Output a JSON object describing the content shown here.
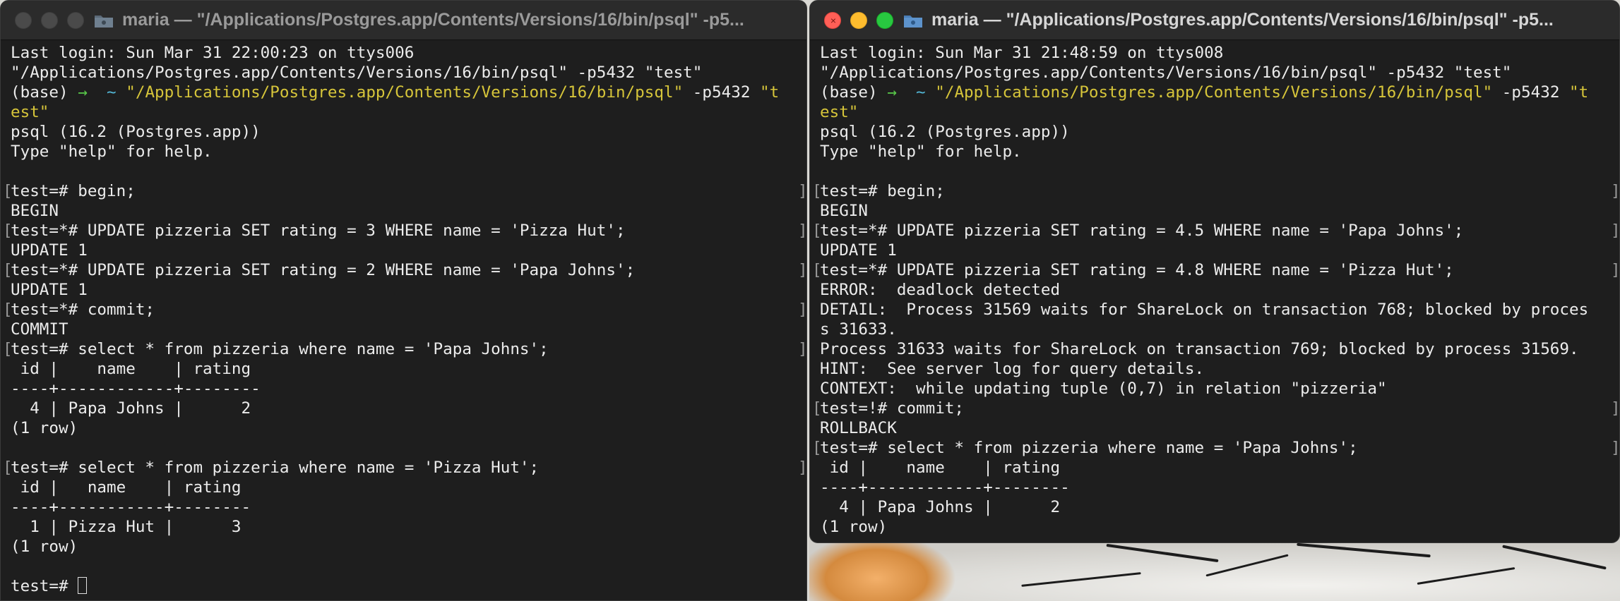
{
  "colors": {
    "terminal_bg": "#1e1e1e",
    "text": "#ececec",
    "prompt_arrow": "#59c94a",
    "prompt_tilde": "#53b7d6",
    "command_text": "#d6c53a",
    "close": "#ff5f57",
    "minimize": "#febc2e",
    "zoom": "#28c840"
  },
  "left": {
    "title": "maria — \"/Applications/Postgres.app/Contents/Versions/16/bin/psql\" -p5...",
    "lines": [
      "Last login: Sun Mar 31 22:00:23 on ttys006",
      "\"/Applications/Postgres.app/Contents/Versions/16/bin/psql\" -p5432 \"test\"",
      {
        "base": "(base) ",
        "arrow": "→ ",
        "tilde": " ~ ",
        "cmd": "\"/Applications/Postgres.app/Contents/Versions/16/bin/psql\"",
        "opt": " -p5432 ",
        "arg": "\"t"
      },
      "est\"",
      "psql (16.2 (Postgres.app))",
      "Type \"help\" for help.",
      "",
      "test=# begin;",
      "BEGIN",
      "test=*# UPDATE pizzeria SET rating = 3 WHERE name = 'Pizza Hut';",
      "UPDATE 1",
      "test=*# UPDATE pizzeria SET rating = 2 WHERE name = 'Papa Johns';",
      "UPDATE 1",
      "test=*# commit;",
      "COMMIT",
      "test=# select * from pizzeria where name = 'Papa Johns';",
      " id |    name    | rating",
      "----+------------+--------",
      "  4 | Papa Johns |      2",
      "(1 row)",
      "",
      "test=# select * from pizzeria where name = 'Pizza Hut';",
      " id |   name    | rating",
      "----+-----------+--------",
      "  1 | Pizza Hut |      3",
      "(1 row)",
      "",
      "test=# "
    ]
  },
  "right": {
    "title": "maria — \"/Applications/Postgres.app/Contents/Versions/16/bin/psql\" -p5...",
    "lines": [
      "Last login: Sun Mar 31 21:48:59 on ttys008",
      "\"/Applications/Postgres.app/Contents/Versions/16/bin/psql\" -p5432 \"test\"",
      {
        "base": "(base) ",
        "arrow": "→ ",
        "tilde": " ~ ",
        "cmd": "\"/Applications/Postgres.app/Contents/Versions/16/bin/psql\"",
        "opt": " -p5432 ",
        "arg": "\"t"
      },
      "est\"",
      "psql (16.2 (Postgres.app))",
      "Type \"help\" for help.",
      "",
      "test=# begin;",
      "BEGIN",
      "test=*# UPDATE pizzeria SET rating = 4.5 WHERE name = 'Papa Johns';",
      "UPDATE 1",
      "test=*# UPDATE pizzeria SET rating = 4.8 WHERE name = 'Pizza Hut';",
      "ERROR:  deadlock detected",
      "DETAIL:  Process 31569 waits for ShareLock on transaction 768; blocked by proces",
      "s 31633.",
      "Process 31633 waits for ShareLock on transaction 769; blocked by process 31569.",
      "HINT:  See server log for query details.",
      "CONTEXT:  while updating tuple (0,7) in relation \"pizzeria\"",
      "test=!# commit;",
      "ROLLBACK",
      "test=# select * from pizzeria where name = 'Papa Johns';",
      " id |    name    | rating",
      "----+------------+--------",
      "  4 | Papa Johns |      2",
      "(1 row)"
    ]
  }
}
